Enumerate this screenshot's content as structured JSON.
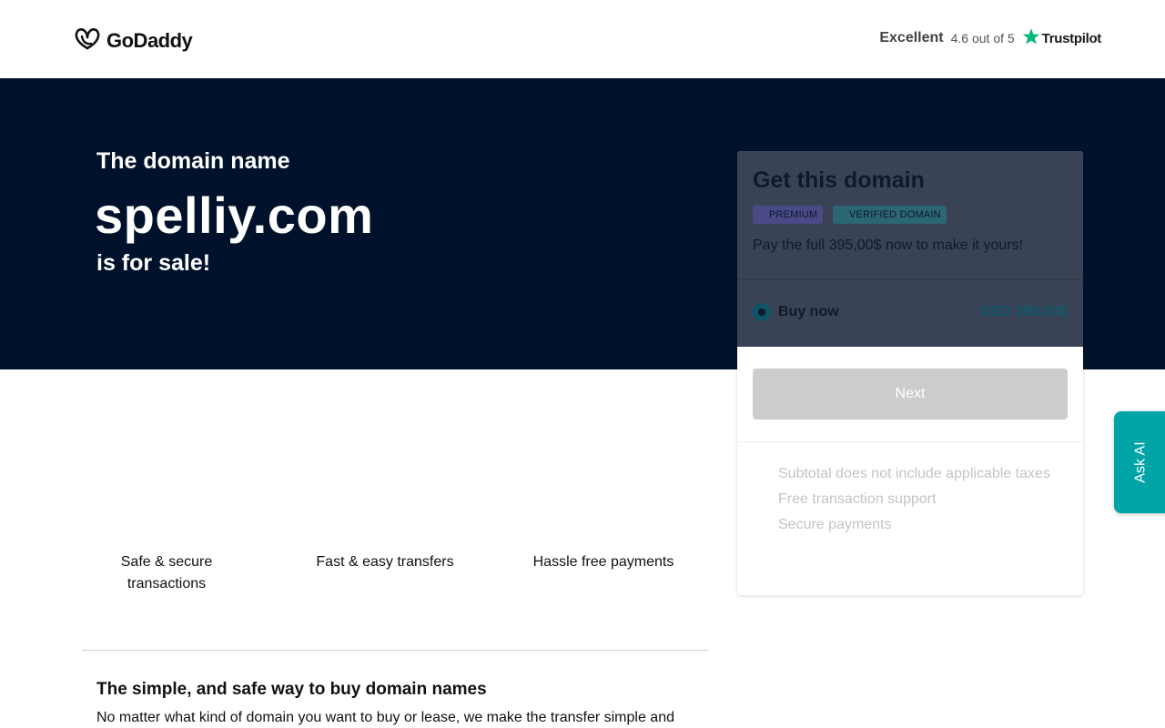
{
  "header": {
    "logo_text": "GoDaddy",
    "logo_icon": "godaddy-logo-icon",
    "trust": {
      "rating_word": "Excellent",
      "score_text": "4.6 out of 5",
      "brand": "Trustpilot",
      "star_icon": "star-icon",
      "star_color": "#00b67a"
    }
  },
  "hero": {
    "line1": "The domain name",
    "domain": "spelliy.com",
    "line3": "is for sale!",
    "background": "#00122b"
  },
  "card": {
    "title": "Get this domain",
    "badges": [
      "PREMIUM",
      "VERIFIED DOMAIN"
    ],
    "description": "Pay the full 395,00$ now to make it yours!",
    "option_label": "Buy now",
    "option_price": "USD 395,00$",
    "next_label": "Next",
    "bullets": [
      "Subtotal does not include applicable taxes",
      "Free transaction support",
      "Secure payments"
    ]
  },
  "features": [
    {
      "label": "Safe & secure transactions"
    },
    {
      "label": "Fast & easy transfers"
    },
    {
      "label": "Hassle free payments"
    }
  ],
  "info": {
    "title": "The simple, and safe way to buy domain names",
    "text": "No matter what kind of domain you want to buy or lease, we make the transfer simple and"
  },
  "ask_ai": {
    "label": "Ask AI",
    "color": "#00a4a6"
  }
}
